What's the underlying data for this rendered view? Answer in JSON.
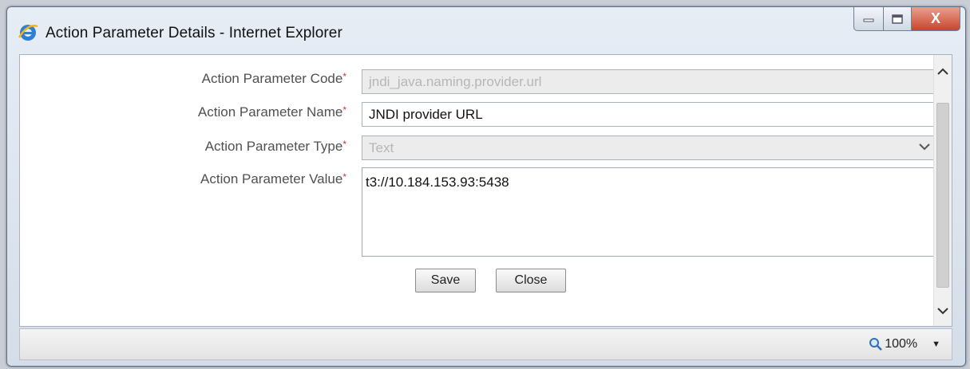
{
  "window": {
    "title": "Action Parameter Details - Internet Explorer",
    "close_glyph": "X"
  },
  "form": {
    "code": {
      "label": "Action Parameter Code",
      "value": "jndi_java.naming.provider.url"
    },
    "name": {
      "label": "Action Parameter Name",
      "value": "JNDI provider URL"
    },
    "type": {
      "label": "Action Parameter Type",
      "value": "Text"
    },
    "value": {
      "label": "Action Parameter Value",
      "value": "t3://10.184.153.93:5438"
    },
    "required_marker": "*"
  },
  "buttons": {
    "save_label": "Save",
    "close_label": "Close"
  },
  "statusbar": {
    "zoom_level": "100%"
  },
  "icons": {
    "app": "internet-explorer-icon",
    "minimize": "minimize-icon",
    "maximize": "maximize-icon",
    "close": "close-icon",
    "dropdown": "chevron-down-icon",
    "zoom": "magnifier-icon"
  }
}
